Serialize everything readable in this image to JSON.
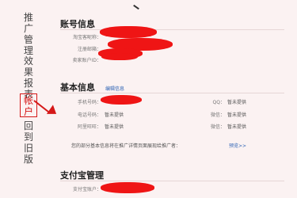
{
  "nav": {
    "items": [
      {
        "label": "推广管理"
      },
      {
        "label": "效果报表"
      },
      {
        "label": "帐户"
      },
      {
        "label": "回到旧版"
      }
    ]
  },
  "account": {
    "title": "账号信息",
    "fields": [
      {
        "label": "淘宝客昵称："
      },
      {
        "label": "注册邮箱："
      },
      {
        "label": "卖家账户ID："
      }
    ]
  },
  "basic": {
    "title": "基本信息",
    "edit_label": "编辑信息",
    "left_fields": [
      {
        "label": "手机号码："
      },
      {
        "label": "电话号码：",
        "value": "暂未提供"
      },
      {
        "label": "阿里旺旺：",
        "value": "暂未提供"
      }
    ],
    "right_fields": [
      {
        "label": "QQ：",
        "value": "暂未提供"
      },
      {
        "label": "微信：",
        "value": "暂未提供"
      },
      {
        "label": "微信：",
        "value": "暂未提供"
      }
    ],
    "note": "您的部分基本信息将在推广详情页面展现给推广者：",
    "preview_label": "预览>>"
  },
  "alipay": {
    "title": "支付宝管理",
    "fields": [
      {
        "label": "支付宝账户："
      }
    ]
  },
  "colors": {
    "accent": "#d51818",
    "link": "#2f64b5",
    "background": "#fbf2f2"
  }
}
